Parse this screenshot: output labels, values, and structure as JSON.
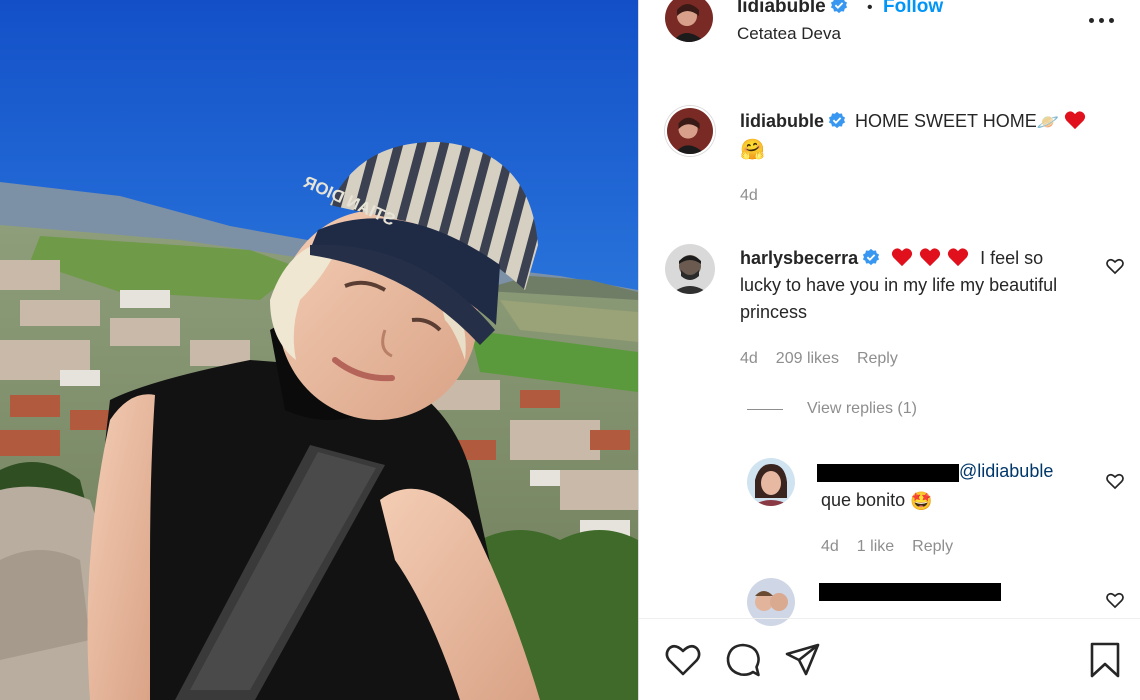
{
  "post": {
    "username": "lidiabuble",
    "dot": "•",
    "follow_label": "Follow",
    "location": "Cetatea Deva"
  },
  "caption": {
    "username": "lidiabuble",
    "text": "HOME SWEET HOME",
    "emoji_planet": "🪐",
    "emoji_smile": "🤗",
    "age": "4d"
  },
  "comments": [
    {
      "username": "harlysbecerra",
      "text_line1": "I feel so",
      "text_rest": "lucky to have you in my life my beautiful princess",
      "age": "4d",
      "likes": "209 likes",
      "reply": "Reply",
      "view_replies": "View replies (1)"
    },
    {
      "mention": "@lidiabuble",
      "text": "que bonito",
      "emoji": "🤩",
      "age": "4d",
      "likes": "1 like",
      "reply": "Reply"
    }
  ],
  "photo": {
    "hat_text": "STIAN DIOR"
  },
  "icons": [
    "verified-badge-icon",
    "more-options-icon",
    "like-comment-icon",
    "like-icon",
    "comment-icon",
    "share-icon",
    "save-icon"
  ],
  "colors": {
    "accent": "#0095f6",
    "text": "#262626",
    "muted": "#8e8e8e",
    "heart": "#ed4956",
    "mention": "#00376b"
  }
}
